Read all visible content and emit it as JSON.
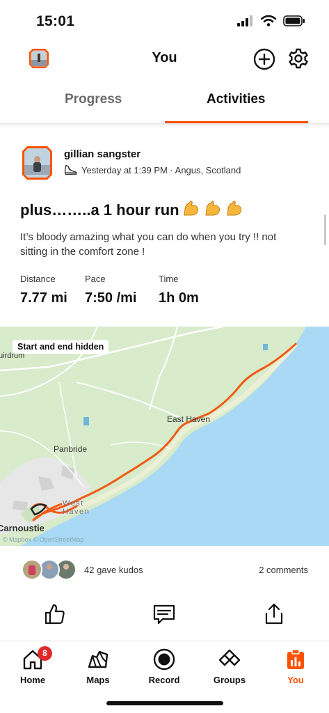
{
  "status_bar": {
    "time": "15:01"
  },
  "header": {
    "title": "You"
  },
  "tabs": [
    {
      "label": "Progress",
      "active": false
    },
    {
      "label": "Activities",
      "active": true
    }
  ],
  "activity": {
    "athlete": "gillian sangster",
    "meta": "Yesterday at 1:39 PM · Angus, Scotland",
    "title": "plus……..a 1 hour run",
    "description": "It’s bloody amazing what you can do when you try !! not sitting in the comfort zone !",
    "stats": [
      {
        "label": "Distance",
        "value": "7.77 mi"
      },
      {
        "label": "Pace",
        "value": "7:50 /mi"
      },
      {
        "label": "Time",
        "value": "1h 0m"
      }
    ],
    "map": {
      "badge": "Start and end hidden",
      "labels": [
        "East Haven",
        "Panbride",
        "West Haven",
        "Carnoustie",
        "uirdrum"
      ],
      "credit": "© Mapbox © OpenStreetMap"
    },
    "kudos": "42 gave kudos",
    "comments": "2 comments"
  },
  "nav": [
    {
      "label": "Home",
      "icon": "home-icon",
      "badge": "8"
    },
    {
      "label": "Maps",
      "icon": "map-icon"
    },
    {
      "label": "Record",
      "icon": "record-icon"
    },
    {
      "label": "Groups",
      "icon": "groups-icon"
    },
    {
      "label": "You",
      "icon": "you-icon",
      "active": true
    }
  ],
  "colors": {
    "accent": "#fc5200",
    "route": "#f05a14",
    "water": "#a9d9f5",
    "land": "#d9eccc"
  }
}
